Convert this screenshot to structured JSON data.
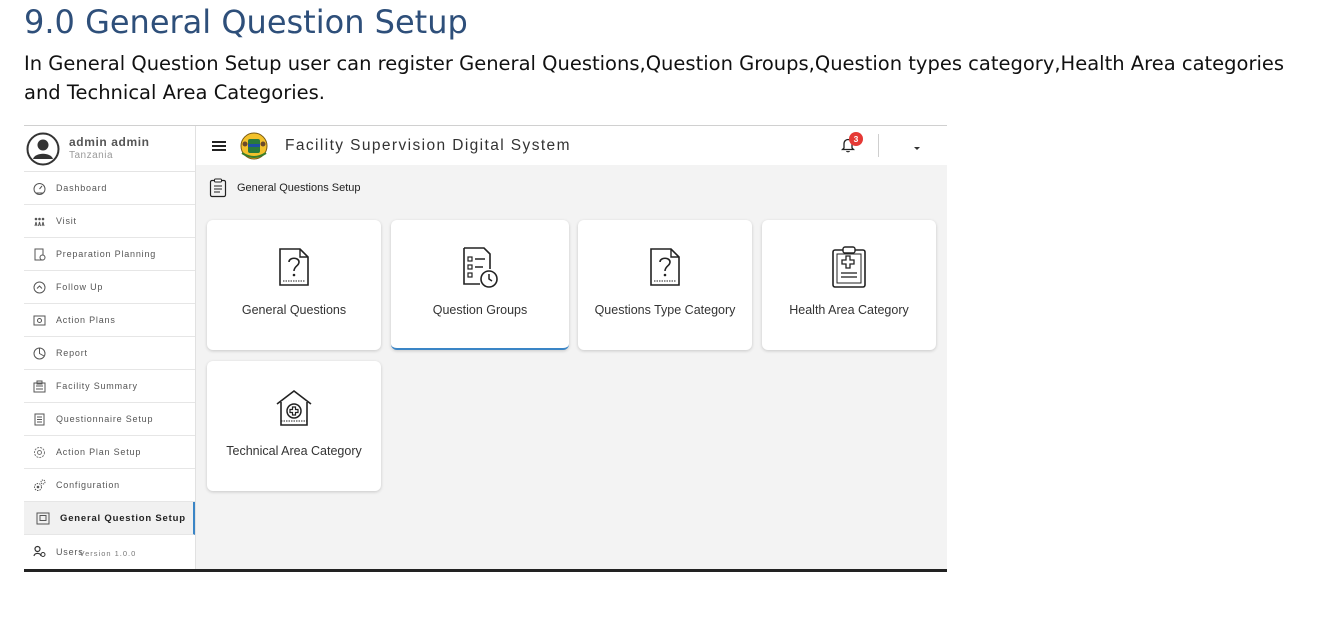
{
  "document": {
    "heading": "9.0 General Question Setup",
    "paragraph": "In General Question Setup user can register General Questions,Question Groups,Question types category,Health Area categories and Technical Area Categories."
  },
  "app": {
    "title": "Facility Supervision Digital System",
    "user": {
      "name": "admin admin",
      "country": "Tanzania"
    },
    "notifications_count": "3",
    "version": "Version 1.0.0",
    "accent_color": "#3a85c6",
    "badge_color": "#e53935"
  },
  "sidebar": {
    "items": [
      {
        "label": "Dashboard",
        "icon": "dashboard-icon"
      },
      {
        "label": "Visit",
        "icon": "visit-icon"
      },
      {
        "label": "Preparation Planning",
        "icon": "preparation-icon"
      },
      {
        "label": "Follow Up",
        "icon": "follow-up-icon"
      },
      {
        "label": "Action Plans",
        "icon": "action-plans-icon"
      },
      {
        "label": "Report",
        "icon": "report-icon"
      },
      {
        "label": "Facility Summary",
        "icon": "facility-icon"
      },
      {
        "label": "Questionnaire Setup",
        "icon": "questionnaire-icon"
      },
      {
        "label": "Action Plan Setup",
        "icon": "action-plan-setup-icon"
      },
      {
        "label": "Configuration",
        "icon": "gears-icon"
      },
      {
        "label": "General Question Setup",
        "icon": "question-setup-icon",
        "active": true
      },
      {
        "label": "Users",
        "icon": "users-icon"
      }
    ]
  },
  "main": {
    "page_title": "General Questions Setup",
    "cards": [
      {
        "label": "General Questions",
        "icon": "question-document-icon"
      },
      {
        "label": "Question Groups",
        "icon": "checklist-timer-icon"
      },
      {
        "label": "Questions Type Category",
        "icon": "question-document-icon"
      },
      {
        "label": "Health Area Category",
        "icon": "medical-clipboard-icon"
      },
      {
        "label": "Technical Area Category",
        "icon": "health-facility-icon"
      }
    ]
  }
}
